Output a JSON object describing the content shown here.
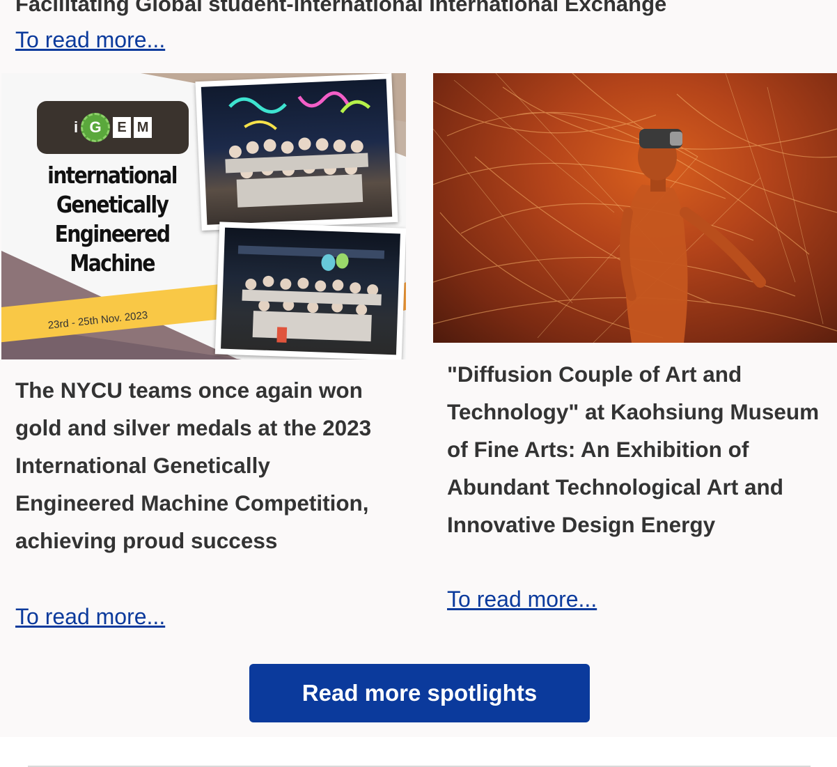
{
  "top_story": {
    "title": "Facilitating Global student-international International Exchange",
    "read_more": "To read more..."
  },
  "cards": [
    {
      "image": {
        "logo_text": "iGEM",
        "logo_i": "i",
        "logo_g": "G",
        "logo_e": "E",
        "logo_m": "M",
        "name_lines": [
          "international",
          "Genetically",
          "Engineered",
          "Machine"
        ],
        "date": "23rd - 25th Nov. 2023"
      },
      "title": "The NYCU teams once again won gold and silver medals at the 2023 International Genetically Engineered Machine Competition, achieving proud success",
      "read_more": "To read more..."
    },
    {
      "image": {
        "alt": "Person wearing a VR headset amid projected orange light lines"
      },
      "title": "\"Diffusion Couple of Art and Technology\" at Kaohsiung Museum of Fine Arts: An Exhibition of Abundant Technological Art and Innovative Design Energy",
      "read_more": "To read more..."
    }
  ],
  "button": {
    "label": "Read more spotlights"
  },
  "colors": {
    "link": "#0b3a9c",
    "button_bg": "#0b3a9c",
    "panel_bg": "#fbf9f9",
    "text": "#333333",
    "accent_yellow": "#f9c846",
    "igem_green": "#5aa83c"
  }
}
